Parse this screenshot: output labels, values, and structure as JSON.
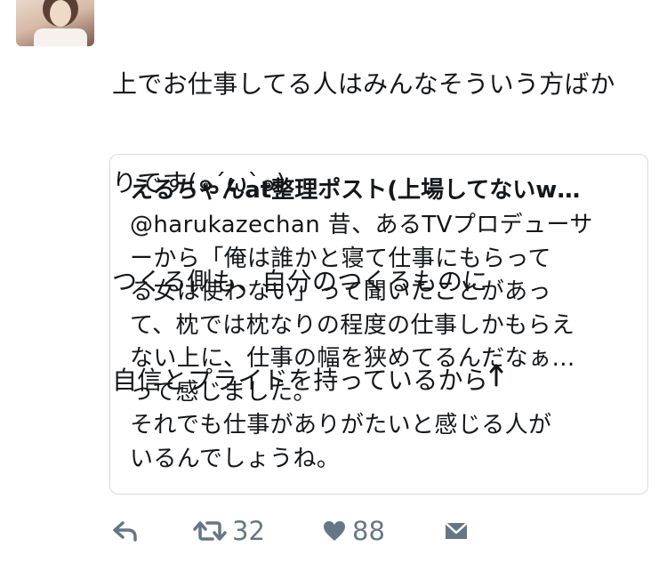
{
  "tweet": {
    "lines": [
      "上でお仕事してる人はみんなそういう方ばか",
      "りです(๑´ω`๑)",
      "つくる側も、自分のつくるものに",
      "自信とプライドを持っているから"
    ],
    "trailing_icon": "up-arrow-icon",
    "text_color": "#14171a"
  },
  "quoted_tweet": {
    "author": "えるちゃんat整理ポスト(上場してないw…",
    "lines": [
      "@harukazechan 昔、あるTVプロデューサ",
      "ーから「俺は誰かと寝て仕事にもらって",
      "る女は使わない」って聞いたことがあっ",
      "て、枕では枕なりの程度の仕事しかもらえ",
      "ない上に、仕事の幅を狭めてるんだなぁ…",
      "って感じました。",
      "それでも仕事がありがたいと感じる人が",
      "いるんでしょうね。"
    ],
    "border_color": "#d4dbe1"
  },
  "actions": {
    "reply_icon": "reply-icon",
    "retweet_icon": "retweet-icon",
    "retweet_count": "32",
    "like_icon": "heart-icon",
    "like_count": "88",
    "dm_icon": "envelope-icon",
    "icon_color": "#657786"
  }
}
